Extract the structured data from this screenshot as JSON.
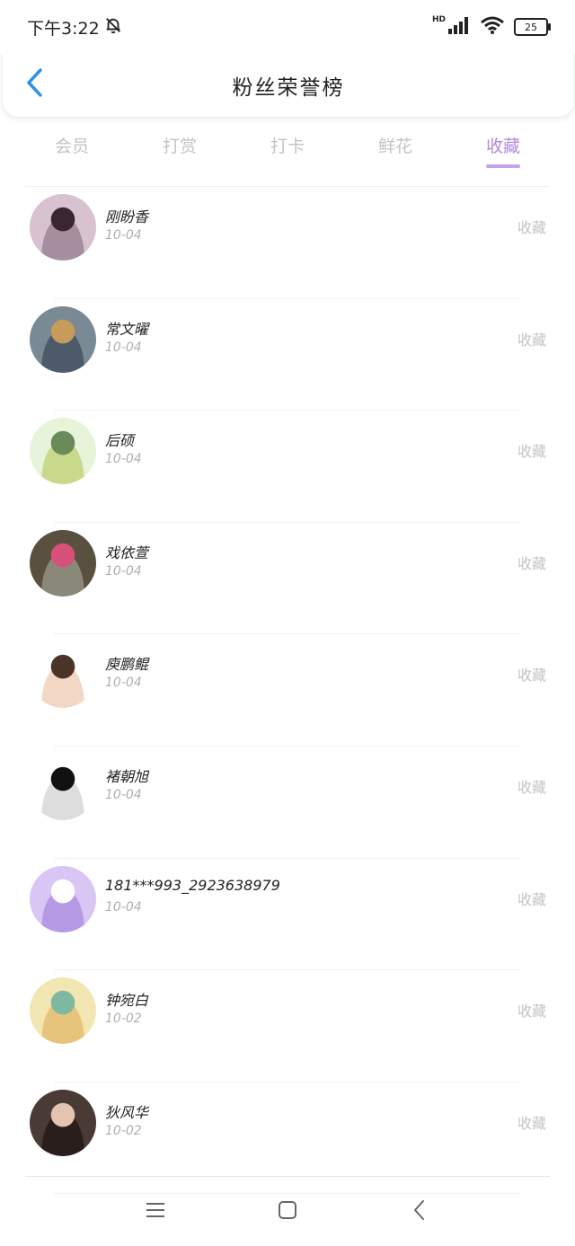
{
  "status_bar": {
    "time": "下午3:22",
    "battery": "25",
    "network_tag": "HD"
  },
  "header": {
    "title": "粉丝荣誉榜"
  },
  "tabs": [
    {
      "label": "会员",
      "active": false
    },
    {
      "label": "打赏",
      "active": false
    },
    {
      "label": "打卡",
      "active": false
    },
    {
      "label": "鲜花",
      "active": false
    },
    {
      "label": "收藏",
      "active": true
    }
  ],
  "list": [
    {
      "name": "刚盼香",
      "date": "10-04",
      "action": "收藏",
      "avatar_colors": [
        "#d8c2d0",
        "#3a2630",
        "#a58f9f"
      ]
    },
    {
      "name": "常文曜",
      "date": "10-04",
      "action": "收藏",
      "avatar_colors": [
        "#7a8a95",
        "#c79b5a",
        "#4d5a6a"
      ]
    },
    {
      "name": "后硕",
      "date": "10-04",
      "action": "收藏",
      "avatar_colors": [
        "#e7f4da",
        "#6a8a5a",
        "#c9d98c"
      ]
    },
    {
      "name": "戏依萱",
      "date": "10-04",
      "action": "收藏",
      "avatar_colors": [
        "#5a5040",
        "#d6507a",
        "#8a8878"
      ]
    },
    {
      "name": "庾鹏鲲",
      "date": "10-04",
      "action": "收藏",
      "avatar_colors": [
        "#ffffff",
        "#4b3426",
        "#f2d8c4"
      ]
    },
    {
      "name": "褚朝旭",
      "date": "10-04",
      "action": "收藏",
      "avatar_colors": [
        "#ffffff",
        "#111111",
        "#dddddd"
      ]
    },
    {
      "name": "181***993_2923638979",
      "date": "10-04",
      "action": "收藏",
      "avatar_colors": [
        "#d9c6f5",
        "#ffffff",
        "#b79ae6"
      ]
    },
    {
      "name": "钟宛白",
      "date": "10-02",
      "action": "收藏",
      "avatar_colors": [
        "#f2e6b3",
        "#7fb8a0",
        "#e7c47c"
      ]
    },
    {
      "name": "狄风华",
      "date": "10-02",
      "action": "收藏",
      "avatar_colors": [
        "#4a3a35",
        "#e4c4b0",
        "#2a1e1c"
      ]
    }
  ],
  "colors": {
    "accent": "#b389dd",
    "back_icon": "#2e93e6",
    "muted": "#c4c4c4"
  }
}
